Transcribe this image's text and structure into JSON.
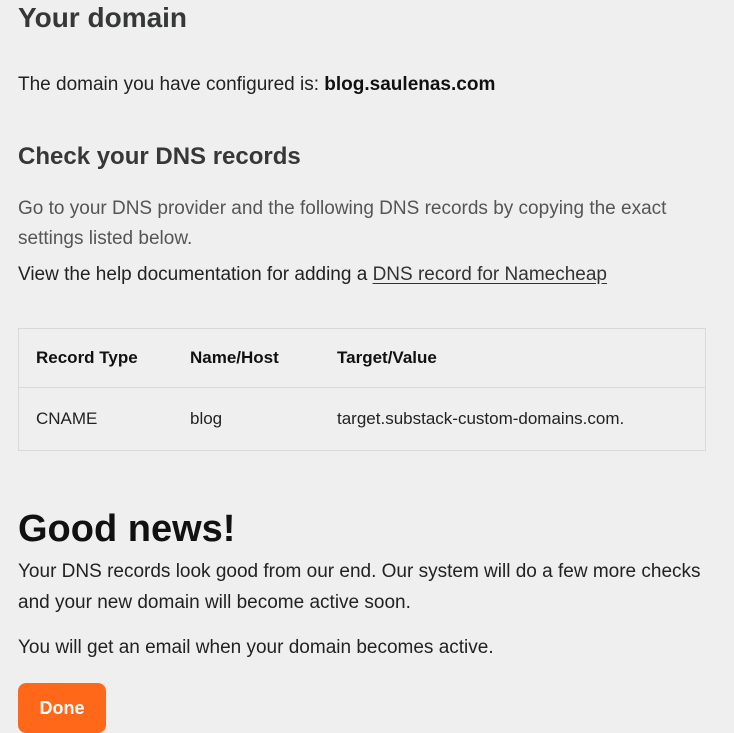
{
  "domain_section": {
    "title": "Your domain",
    "configured_prefix": "The domain you have configured is: ",
    "domain": "blog.saulenas.com"
  },
  "dns_section": {
    "title": "Check your DNS records",
    "intro": "Go to your DNS provider and the following DNS records by copying the exact settings listed below.",
    "help_prefix": "View the help documentation for adding a ",
    "help_link": "DNS record for Namecheap"
  },
  "records_table": {
    "headers": [
      "Record Type",
      "Name/Host",
      "Target/Value"
    ],
    "rows": [
      [
        "CNAME",
        "blog",
        "target.substack-custom-domains.com."
      ]
    ]
  },
  "status": {
    "title": "Good news!",
    "body": "Your DNS records look good from our end. Our system will do a few more checks and your new domain will become active soon.",
    "email_note": "You will get an email when your domain becomes active."
  },
  "actions": {
    "done_label": "Done"
  },
  "colors": {
    "accent": "#ff6719",
    "background": "#efefef"
  }
}
